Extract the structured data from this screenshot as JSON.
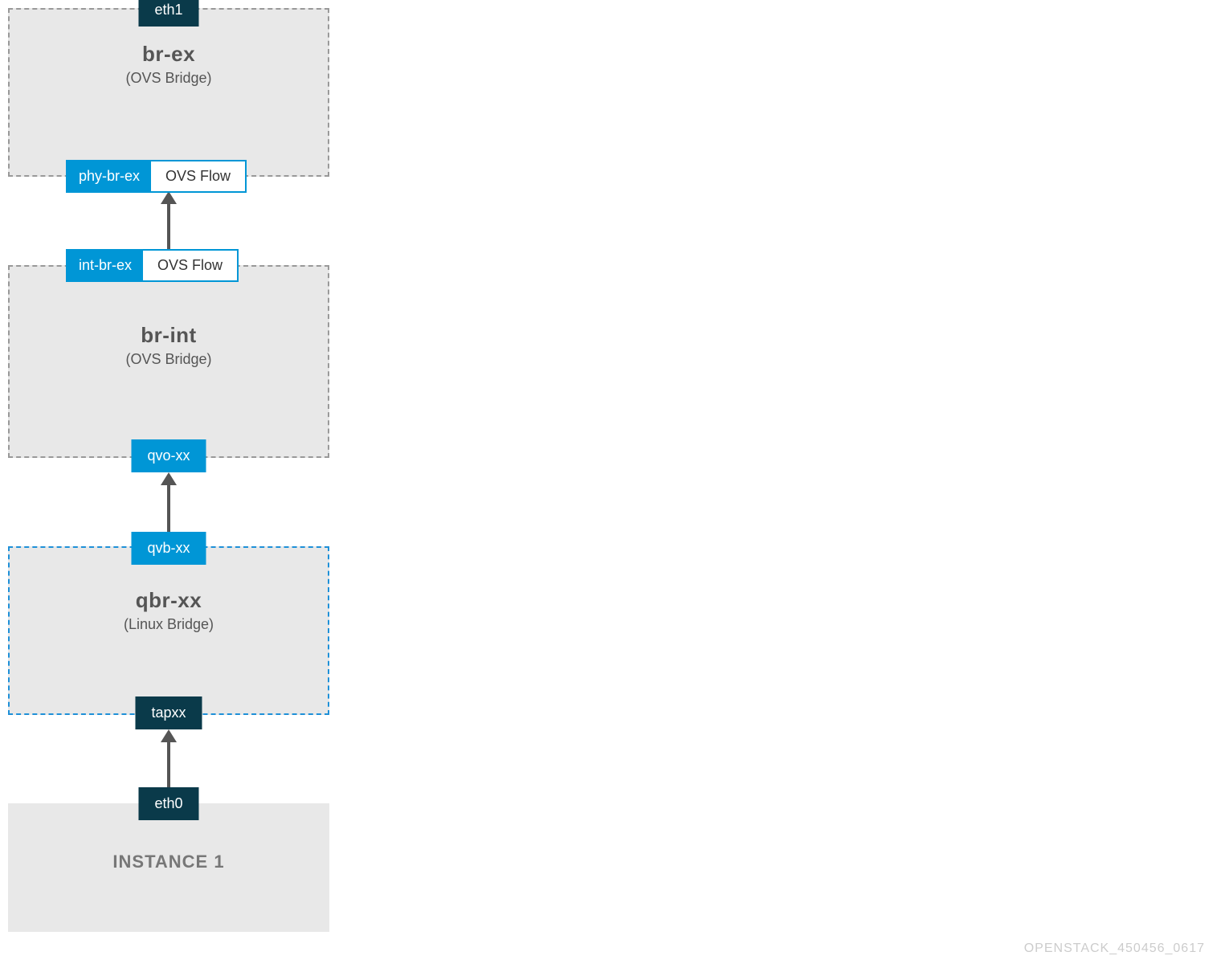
{
  "boxes": {
    "brex": {
      "top_badge": "eth1",
      "title": "br-ex",
      "subtitle": "(OVS Bridge)",
      "bottom_pair_left": "phy-br-ex",
      "bottom_pair_right": "OVS Flow"
    },
    "brint": {
      "top_pair_left": "int-br-ex",
      "top_pair_right": "OVS Flow",
      "title": "br-int",
      "subtitle": "(OVS Bridge)",
      "bottom_badge": "qvo-xx"
    },
    "qbr": {
      "top_badge": "qvb-xx",
      "title": "qbr-xx",
      "subtitle": "(Linux Bridge)",
      "bottom_badge": "tapxx"
    },
    "instance": {
      "top_badge": "eth0",
      "title": "INSTANCE 1"
    }
  },
  "footer": "OPENSTACK_450456_0617"
}
